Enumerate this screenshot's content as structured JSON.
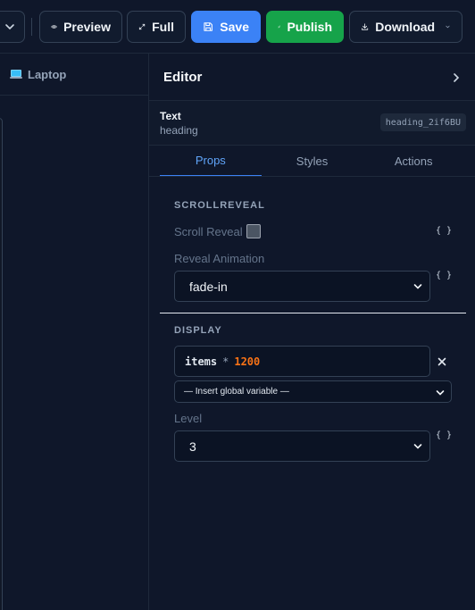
{
  "toolbar": {
    "preview_label": "Preview",
    "full_label": "Full",
    "save_label": "Save",
    "publish_label": "Publish",
    "download_label": "Download",
    "save_color": "#3b82f6",
    "publish_color": "#16a34a"
  },
  "canvas": {
    "device_label": "Laptop",
    "device_icon": "laptop-icon"
  },
  "editor": {
    "title": "Editor",
    "component_type": "Text",
    "component_subtype": "heading",
    "component_id": "heading_2if6BU",
    "tabs": [
      {
        "label": "Props",
        "active": true
      },
      {
        "label": "Styles",
        "active": false
      },
      {
        "label": "Actions",
        "active": false
      }
    ],
    "scrollreveal": {
      "section_title": "SCROLLREVEAL",
      "scroll_reveal_label": "Scroll Reveal",
      "scroll_reveal_checked": false,
      "reveal_animation_label": "Reveal Animation",
      "reveal_animation_value": "fade-in",
      "braces": "{ }"
    },
    "display": {
      "section_title": "DISPLAY",
      "expression_var": "items",
      "expression_op": "*",
      "expression_num": "1200",
      "global_variable_placeholder": "— Insert global variable —",
      "level_label": "Level",
      "level_value": "3",
      "braces": "{ }"
    }
  }
}
